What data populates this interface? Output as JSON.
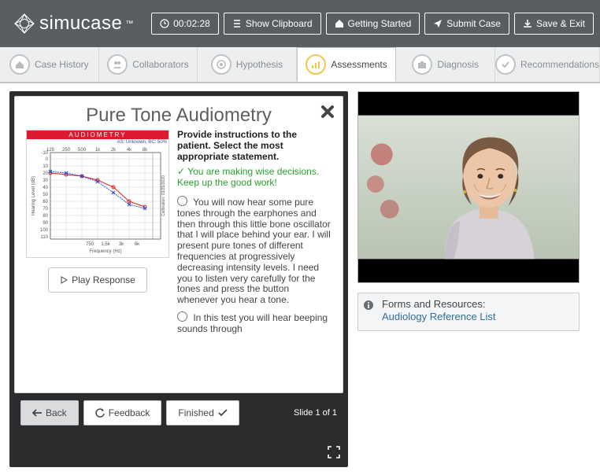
{
  "brand": "simucase",
  "header": {
    "timer": "00:02:28",
    "show_clipboard": "Show Clipboard",
    "getting_started": "Getting Started",
    "submit_case": "Submit Case",
    "save_exit": "Save & Exit"
  },
  "tabs": [
    {
      "label": "Case History"
    },
    {
      "label": "Collaborators"
    },
    {
      "label": "Hypothesis"
    },
    {
      "label": "Assessments",
      "active": true
    },
    {
      "label": "Diagnosis"
    },
    {
      "label": "Recommendations"
    }
  ],
  "slide": {
    "title": "Pure Tone Audiometry",
    "prompt": "Provide instructions to the patient. Select the most appropriate statement.",
    "feedback": "✓ You are making wise decisions. Keep up the good work!",
    "options": [
      "You will now hear some pure tones through the earphones and then through this little bone oscillator that I will place behind your ear. I will present pure tones of different frequencies at progressively decreasing intensity levels. I need you to listen very carefully for the tones and press the button whenever you hear a tone.",
      "In this test you will hear beeping sounds through"
    ],
    "play_btn": "Play Response",
    "back_btn": "Back",
    "feedback_btn": "Feedback",
    "finished_btn": "Finished",
    "slide_counter": "Slide 1 of 1"
  },
  "chart_data": {
    "type": "line",
    "title": "AUDIOMETRY",
    "legend_line": "AS: Unknown, BC: 50%",
    "xlabel": "Frequency (Hz)",
    "ylabel": "Hearing Level (dB)",
    "xticks": [
      125,
      250,
      500,
      "1k",
      "2k",
      "4k",
      "8k"
    ],
    "xticks_minor": [
      750,
      "1.5k",
      "3k",
      "6k"
    ],
    "yticks": [
      -10,
      0,
      10,
      20,
      30,
      40,
      50,
      60,
      70,
      80,
      90,
      100,
      110
    ],
    "ylim": [
      -10,
      110
    ],
    "series": [
      {
        "name": "Right AC (O, red)",
        "freq_hz": [
          125,
          250,
          500,
          1000,
          2000,
          4000,
          8000
        ],
        "threshold_db": [
          20,
          22,
          25,
          30,
          40,
          60,
          68
        ]
      },
      {
        "name": "Left AC (X, blue)",
        "freq_hz": [
          125,
          250,
          500,
          1000,
          2000,
          4000,
          8000
        ],
        "threshold_db": [
          18,
          20,
          24,
          32,
          48,
          65,
          70
        ]
      },
      {
        "name": "Right BC (<, red dashed)",
        "freq_hz": [
          250,
          500,
          1000,
          2000,
          4000
        ],
        "threshold_db": [
          18,
          22,
          30,
          38,
          58
        ]
      },
      {
        "name": "Left BC (>, blue dashed)",
        "freq_hz": [
          250,
          500,
          1000,
          2000,
          4000
        ],
        "threshold_db": [
          17,
          20,
          28,
          45,
          62
        ]
      }
    ]
  },
  "resources": {
    "heading": "Forms and Resources:",
    "link": "Audiology Reference List"
  }
}
